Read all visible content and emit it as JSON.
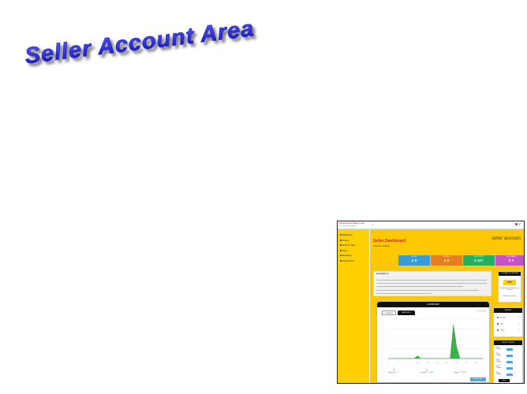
{
  "slide": {
    "heading": "Seller Account Area"
  },
  "thumbnail": {
    "brand": "treasurecaching.co.uk",
    "brand_sub": "find, sell, trade treasure",
    "user_icon": "user-icon",
    "back_icon": "back-arrow-icon",
    "sidebar": [
      {
        "label": "Dashboard"
      },
      {
        "label": "Orders"
      },
      {
        "label": "Items for Sale"
      },
      {
        "label": "Store"
      },
      {
        "label": "Messages"
      },
      {
        "label": "Opportunities"
      }
    ],
    "title": "Seller Dashboard",
    "welcome": "Welcome Jewelry!",
    "account_label": "seller account",
    "stats": [
      {
        "label": "ACTIVE",
        "value": "£ 0",
        "color": "#3a9ad9"
      },
      {
        "label": "PENDING",
        "value": "£ 0",
        "color": "#e67e22"
      },
      {
        "label": "COMPLETED",
        "value": "£ 117",
        "color": "#27ae60"
      },
      {
        "label": "WITHDRAWN",
        "value": "£ 0",
        "color": "#c653c6"
      }
    ],
    "info_title": "INFORMATION",
    "promo": {
      "header": "YOU HAVE NO FEATURED",
      "state": "OFF",
      "text": "Featured items are display on top of search",
      "link": "Change Feature Settings"
    },
    "dashboard": {
      "header": "DASHBOARD",
      "tabs": [
        "ORDERS",
        "AMOUNTS"
      ],
      "range": "Last 30 days",
      "footer": [
        {
          "icon": "trend-icon",
          "label": "Orders count",
          "value": "17"
        },
        {
          "icon": "bag-icon",
          "label": "Purchase",
          "value": "£152.36"
        },
        {
          "icon": "share-icon",
          "label": "Amount",
          "value": "£152.36"
        }
      ],
      "manage_label": "Manage orders"
    },
    "balance": {
      "header": "BALANCE",
      "rows": [
        {
          "label": "Pending",
          "value": "0"
        },
        {
          "label": "Sold",
          "value": "0"
        },
        {
          "label": "Ledger",
          "value": "0"
        }
      ]
    },
    "recent": {
      "header": "RECENT ORDERS",
      "rows": [
        {
          "name": "Pearl Pendant"
        },
        {
          "name": "Pearl Pendant"
        },
        {
          "name": "Pearl Pendant"
        },
        {
          "name": "Pearl Pendant"
        },
        {
          "name": "Pearl Pendant"
        }
      ],
      "more_label": "More"
    },
    "chart_data": {
      "type": "area",
      "title": "",
      "categories": [
        "1",
        "2",
        "3",
        "4",
        "5",
        "6",
        "7",
        "8",
        "9",
        "10",
        "11",
        "12",
        "13",
        "14",
        "15",
        "16",
        "17",
        "18",
        "19",
        "20",
        "21",
        "22",
        "23",
        "24",
        "25",
        "26",
        "27",
        "28",
        "29",
        "30"
      ],
      "series": [
        {
          "values": [
            0,
            0,
            0,
            0,
            0,
            0,
            0,
            0,
            0,
            1,
            0,
            0,
            0,
            0,
            0,
            0,
            0,
            0,
            0,
            0,
            12,
            4,
            0,
            0,
            0,
            0,
            0,
            0,
            0,
            0
          ],
          "color": "#3bb34a"
        }
      ],
      "ylim": [
        0,
        14
      ],
      "grid": true
    }
  }
}
